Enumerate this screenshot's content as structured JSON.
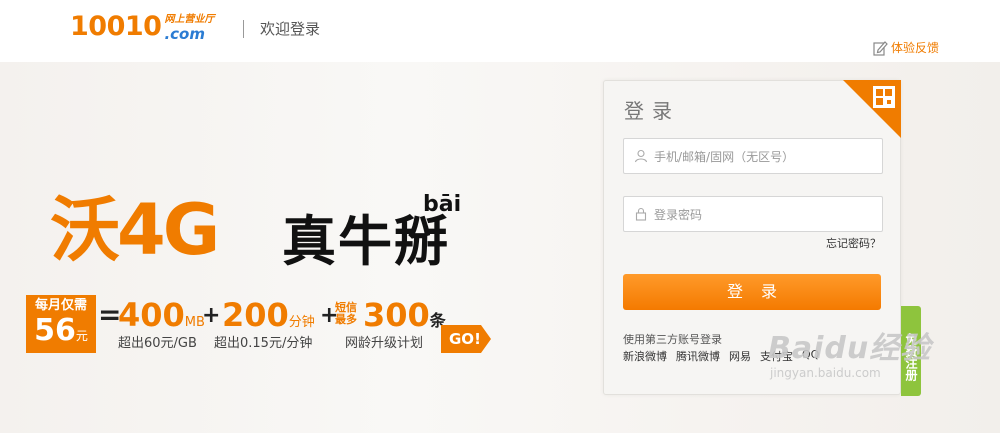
{
  "header": {
    "logo_number": "10010",
    "logo_cn": "网上营业厅",
    "logo_com": ".com",
    "welcome": "欢迎登录",
    "feedback": "体验反馈",
    "feedback_icon": "edit-icon"
  },
  "promo": {
    "headline": "沃4G",
    "headline2": "真牛掰",
    "pinyin": "bāi",
    "price_top": "每月仅需",
    "price_num": "56",
    "price_unit": "元",
    "equals": "=",
    "data_amount": "400",
    "data_unit": "MB",
    "data_sub": "超出60元/GB",
    "plus1": "+",
    "voice_amount": "200",
    "voice_unit": "分钟",
    "voice_sub": "超出0.15元/分钟",
    "plus2": "+",
    "sms_label_1": "短信",
    "sms_label_2": "最多",
    "sms_amount": "300",
    "sms_unit": "条",
    "sms_sub": "网龄升级计划",
    "go": "GO!"
  },
  "login": {
    "title": "登录",
    "username_placeholder": "手机/邮箱/固网（无区号）",
    "password_placeholder": "登录密码",
    "forgot": "忘记密码？",
    "submit": "登录",
    "third_party_label": "使用第三方账号登录",
    "third_party": [
      "新浪微博",
      "腾讯微博",
      "网易",
      "支付宝",
      "QQ"
    ],
    "free_tab": "免费注册",
    "accent_color": "#f07c00"
  },
  "watermark": {
    "logo": "Baidu经验",
    "url": "jingyan.baidu.com"
  }
}
